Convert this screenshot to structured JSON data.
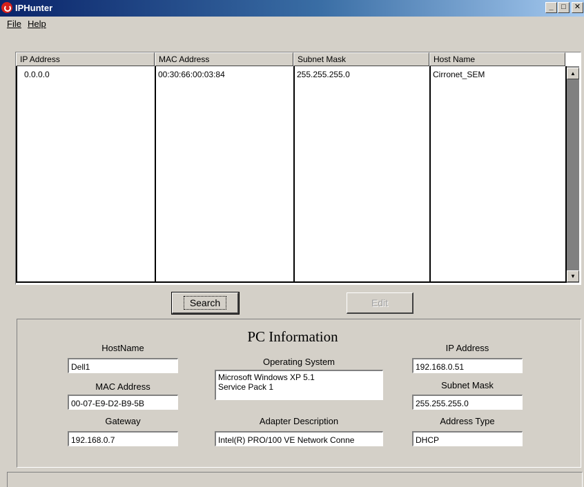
{
  "window": {
    "title": "IPHunter"
  },
  "menu": {
    "file": "File",
    "help": "Help"
  },
  "table": {
    "columns": [
      "IP Address",
      "MAC Address",
      "Subnet Mask",
      "Host Name"
    ],
    "rows": [
      {
        "ip": "0.0.0.0",
        "mac": "00:30:66:00:03:84",
        "subnet": "255.255.255.0",
        "host": "Cirronet_SEM"
      }
    ]
  },
  "buttons": {
    "search": "Search",
    "edit": "Edit"
  },
  "pc_info": {
    "title": "PC Information",
    "hostname_label": "HostName",
    "hostname": "Dell1",
    "mac_label": "MAC Address",
    "mac": "00-07-E9-D2-B9-5B",
    "gateway_label": "Gateway",
    "gateway": "192.168.0.7",
    "os_label": "Operating System",
    "os_line1": "Microsoft Windows XP 5.1",
    "os_line2": "Service Pack 1",
    "adapter_label": "Adapter Description",
    "adapter": "Intel(R) PRO/100 VE Network Conne",
    "ip_label": "IP Address",
    "ip": "192.168.0.51",
    "subnet_label": "Subnet Mask",
    "subnet": "255.255.255.0",
    "addrtype_label": "Address Type",
    "addrtype": "DHCP"
  }
}
